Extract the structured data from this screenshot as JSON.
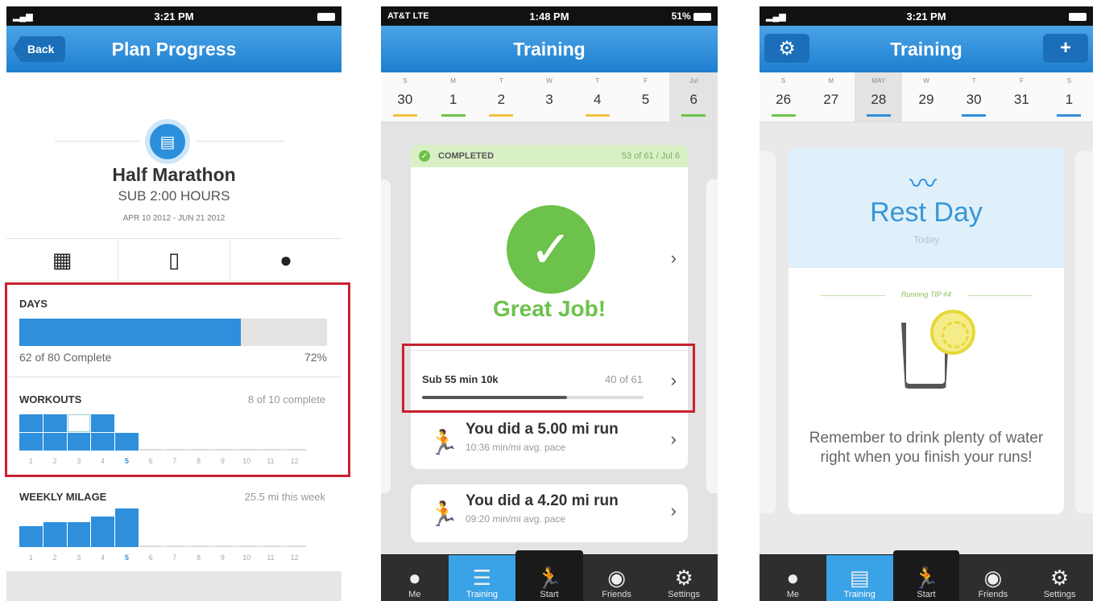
{
  "phone1": {
    "status": {
      "time": "3:21 PM",
      "signal": "▂▄▆"
    },
    "nav": {
      "title": "Plan Progress",
      "back": "Back"
    },
    "plan": {
      "title": "Half Marathon",
      "subtitle": "SUB 2:00 HOURS",
      "dates": "APR 10 2012 - JUN 21 2012"
    },
    "tabs": [
      "calendar-icon",
      "clipboard-icon",
      "person-icon"
    ],
    "days": {
      "label": "DAYS",
      "complete_text": "62 of 80 Complete",
      "percent_text": "72%",
      "fraction": 0.72
    },
    "workouts": {
      "label": "WORKOUTS",
      "summary": "8 of 10 complete",
      "weeks": [
        "1",
        "2",
        "3",
        "4",
        "5",
        "6",
        "7",
        "8",
        "9",
        "10",
        "11",
        "12"
      ],
      "values": [
        2,
        2,
        1,
        2,
        1,
        0,
        0,
        0,
        0,
        0,
        0,
        0
      ],
      "planned": [
        2,
        2,
        2,
        2,
        1,
        0,
        0,
        0,
        0,
        0,
        0,
        0
      ],
      "current_week": "5"
    },
    "mileage": {
      "label": "WEEKLY MILAGE",
      "summary": "25.5 mi this week",
      "weeks": [
        "1",
        "2",
        "3",
        "4",
        "5",
        "6",
        "7",
        "8",
        "9",
        "10",
        "11",
        "12"
      ],
      "values": [
        0.55,
        0.65,
        0.65,
        0.8,
        1.0,
        0,
        0,
        0,
        0,
        0,
        0,
        0
      ],
      "current_week": "5"
    }
  },
  "phone2": {
    "status": {
      "carrier": "AT&T  LTE",
      "time": "1:48 PM",
      "right": "51%"
    },
    "nav": {
      "title": "Training"
    },
    "week": [
      {
        "dn": "S",
        "dd": "30",
        "mark": "#f0c040"
      },
      {
        "dn": "M",
        "dd": "1",
        "mark": "#6cc24a"
      },
      {
        "dn": "T",
        "dd": "2",
        "mark": "#f0c040"
      },
      {
        "dn": "W",
        "dd": "3",
        "mark": ""
      },
      {
        "dn": "T",
        "dd": "4",
        "mark": "#f0c040"
      },
      {
        "dn": "F",
        "dd": "5",
        "mark": ""
      },
      {
        "dn": "Jul",
        "dd": "6",
        "mark": "#6cc24a"
      }
    ],
    "completed": {
      "label": "COMPLETED",
      "right": "53 of 61 / Jul 6",
      "message": "Great Job!"
    },
    "goal": {
      "title": "Sub 55 min 10k",
      "count": "40 of 61",
      "fraction": 0.656
    },
    "runs": [
      {
        "title": "You did a 5.00 mi run",
        "sub": "10:36 min/mi avg. pace"
      },
      {
        "title": "You did a 4.20 mi run",
        "sub": "09:20 min/mi avg. pace"
      }
    ],
    "tabs": [
      {
        "label": "Me",
        "icon": "person-icon"
      },
      {
        "label": "Training",
        "icon": "list-icon"
      },
      {
        "label": "Start",
        "icon": "runner-icon"
      },
      {
        "label": "Friends",
        "icon": "friends-icon"
      },
      {
        "label": "Settings",
        "icon": "gear-icon"
      }
    ]
  },
  "phone3": {
    "status": {
      "time": "3:21 PM"
    },
    "nav": {
      "title": "Training"
    },
    "week": [
      {
        "dn": "S",
        "dd": "26",
        "mark": "#6cc24a"
      },
      {
        "dn": "M",
        "dd": "27",
        "mark": ""
      },
      {
        "dn": "MAY",
        "dd": "28",
        "mark": "#2e8fdc"
      },
      {
        "dn": "W",
        "dd": "29",
        "mark": ""
      },
      {
        "dn": "T",
        "dd": "30",
        "mark": "#2e8fdc"
      },
      {
        "dn": "F",
        "dd": "31",
        "mark": ""
      },
      {
        "dn": "S",
        "dd": "1",
        "mark": "#2e8fdc"
      }
    ],
    "rest": {
      "title": "Rest Day",
      "sub": "Today",
      "tip_label": "Running TIP #4",
      "tip_text": "Remember to drink plenty of water right when you finish your runs!"
    },
    "tabs": [
      {
        "label": "Me",
        "icon": "person-icon"
      },
      {
        "label": "Training",
        "icon": "clipboard-icon"
      },
      {
        "label": "Start",
        "icon": "runner-icon"
      },
      {
        "label": "Friends",
        "icon": "friends-icon"
      },
      {
        "label": "Settings",
        "icon": "gear-icon"
      }
    ]
  },
  "colors": {
    "accent": "#2e8fdc",
    "success": "#6cc24a",
    "highlight": "#c8202f"
  }
}
